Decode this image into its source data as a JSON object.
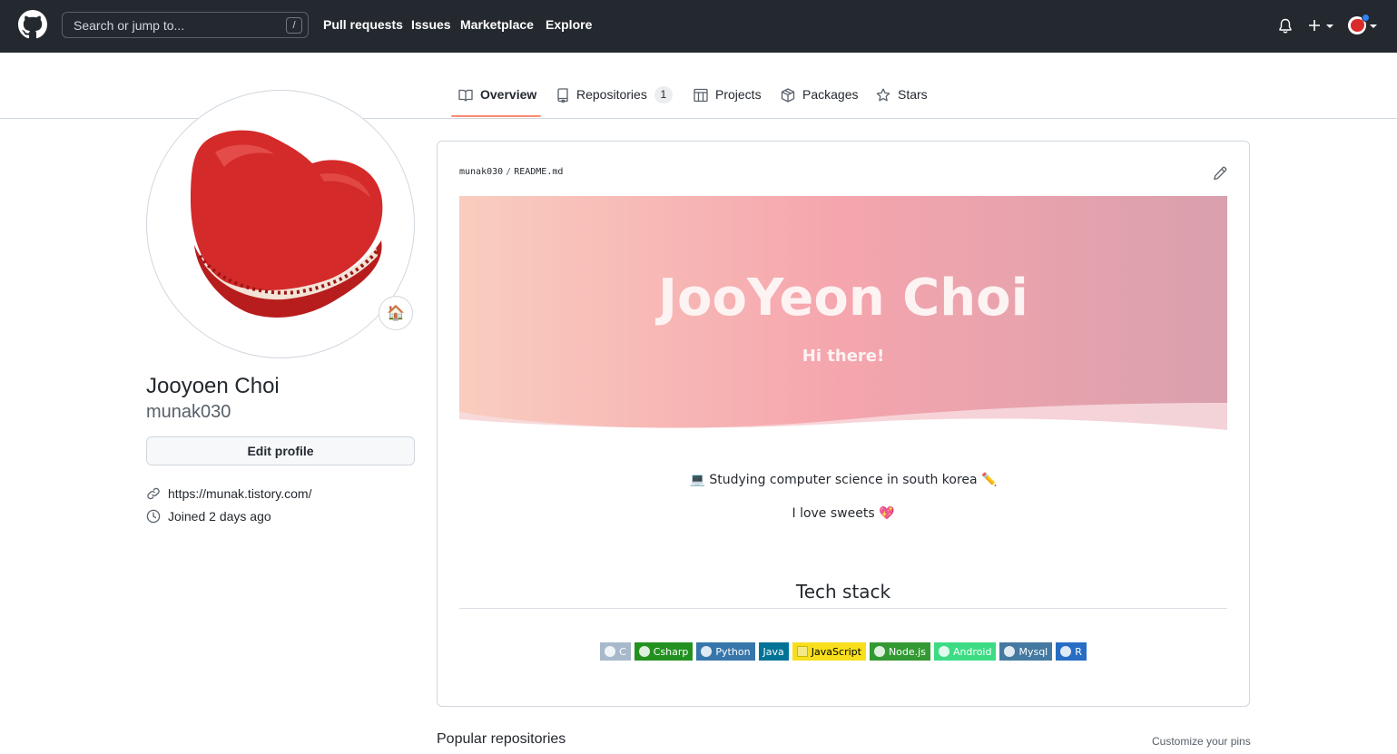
{
  "header": {
    "search_placeholder": "Search or jump to...",
    "search_shortcut": "/",
    "nav": [
      "Pull requests",
      "Issues",
      "Marketplace",
      "Explore"
    ]
  },
  "tabs": [
    {
      "label": "Overview",
      "icon": "book-icon",
      "active": true
    },
    {
      "label": "Repositories",
      "icon": "repo-icon",
      "count": "1"
    },
    {
      "label": "Projects",
      "icon": "project-icon"
    },
    {
      "label": "Packages",
      "icon": "package-icon"
    },
    {
      "label": "Stars",
      "icon": "star-icon"
    }
  ],
  "profile": {
    "full_name": "Jooyoen Choi",
    "login": "munak030",
    "edit_button": "Edit profile",
    "website": "https://munak.tistory.com/",
    "joined": "Joined 2 days ago",
    "status_emoji": "🏠"
  },
  "readme": {
    "owner": "munak030",
    "file": "README.md",
    "banner_title": "JooYeon Choi",
    "banner_subtitle": "Hi there!",
    "line1": "Studying computer science in south korea",
    "line1_emoji_start": "💻",
    "line1_emoji_end": "✏️",
    "line2": "I love sweets",
    "line2_emoji": "💖",
    "tech_heading": "Tech stack",
    "badges": [
      {
        "label": "C",
        "color": "#a8b9cc"
      },
      {
        "label": "Csharp",
        "color": "#239120"
      },
      {
        "label": "Python",
        "color": "#3776ab"
      },
      {
        "label": "Java",
        "color": "#007396"
      },
      {
        "label": "JavaScript",
        "color": "#f7df1e"
      },
      {
        "label": "Node.js",
        "color": "#339933"
      },
      {
        "label": "Android",
        "color": "#3ddc84"
      },
      {
        "label": "Mysql",
        "color": "#4479a1"
      },
      {
        "label": "R",
        "color": "#276dc3"
      }
    ]
  },
  "footer": {
    "popular_heading": "Popular repositories",
    "customize_link": "Customize your pins"
  },
  "colors": {
    "header_bg": "#24292f",
    "tab_underline": "#fd8c73",
    "banner_gradient": [
      "#f9cdbf",
      "#f5a5ad",
      "#d9a0ad"
    ]
  }
}
